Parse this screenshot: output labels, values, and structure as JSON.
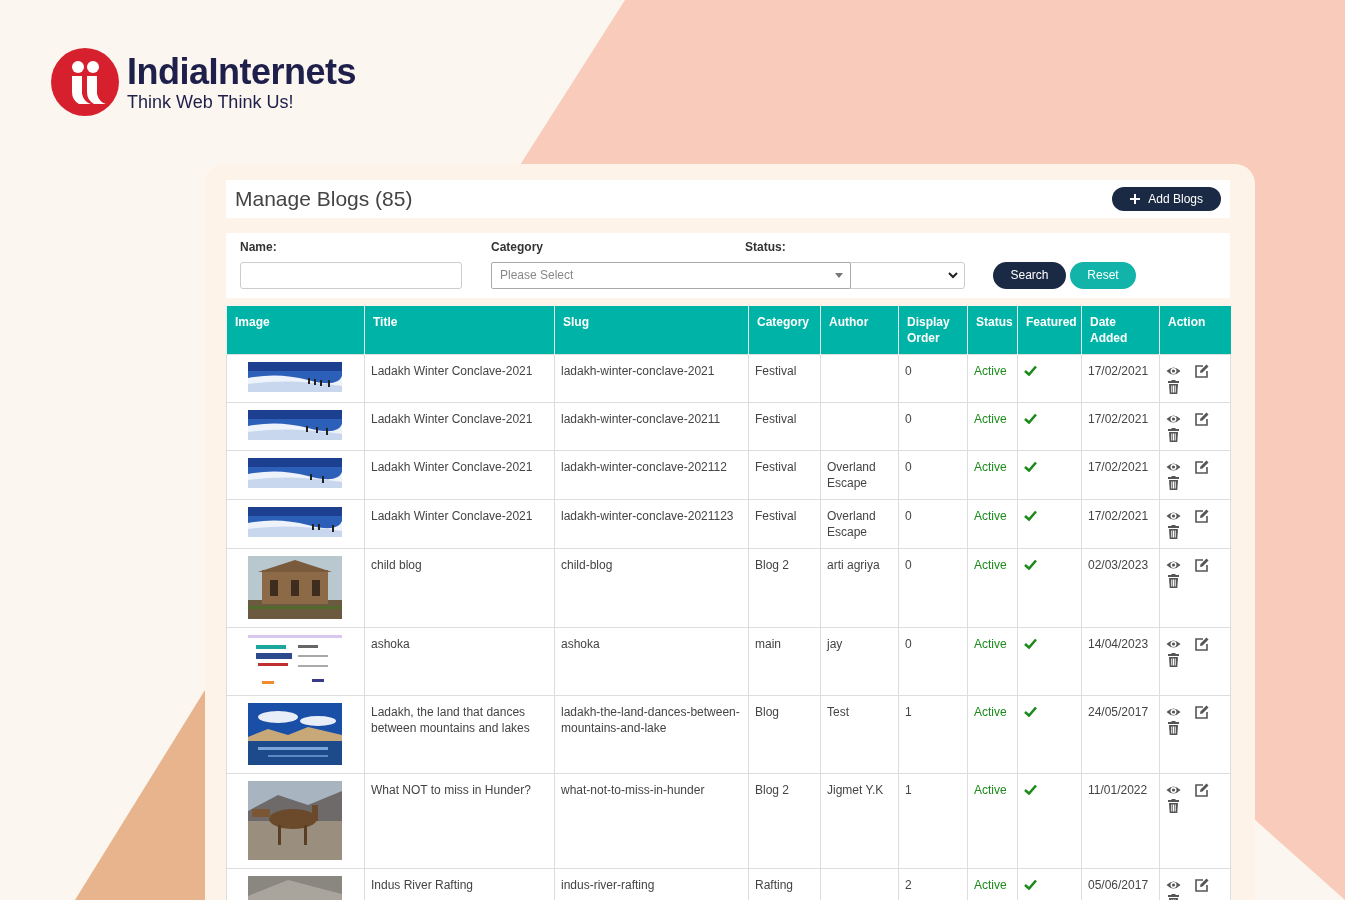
{
  "brand": {
    "name": "IndiaInternets",
    "tagline": "Think Web Think Us!"
  },
  "page": {
    "title": "Manage Blogs (85)",
    "add_button": "Add Blogs"
  },
  "filters": {
    "name_label": "Name:",
    "category_label": "Category",
    "category_placeholder": "Please Select",
    "status_label": "Status:",
    "search_button": "Search",
    "reset_button": "Reset"
  },
  "table": {
    "columns": [
      "Image",
      "Title",
      "Slug",
      "Category",
      "Author",
      "Display Order",
      "Status",
      "Featured",
      "Date Added",
      "Action"
    ],
    "rows": [
      {
        "title": "Ladakh Winter Conclave-2021",
        "slug": "ladakh-winter-conclave-2021",
        "category": "Festival",
        "display_order": "0",
        "status": "Active",
        "featured": true,
        "date_added": "17/02/2021"
      },
      {
        "title": "Ladakh Winter Conclave-2021",
        "slug": "ladakh-winter-conclave-20211",
        "category": "Festival",
        "display_order": "0",
        "status": "Active",
        "featured": true,
        "date_added": "17/02/2021"
      },
      {
        "title": "Ladakh Winter Conclave-2021",
        "slug": "ladakh-winter-conclave-202112",
        "category": "Festival",
        "author": "Overland Escape",
        "display_order": "0",
        "status": "Active",
        "featured": true,
        "date_added": "17/02/2021"
      },
      {
        "title": "Ladakh Winter Conclave-2021",
        "slug": "ladakh-winter-conclave-2021123",
        "category": "Festival",
        "author": "Overland Escape",
        "display_order": "0",
        "status": "Active",
        "featured": true,
        "date_added": "17/02/2021"
      },
      {
        "title": "child blog",
        "slug": "child-blog",
        "category": "Blog 2",
        "author": "arti agriya",
        "display_order": "0",
        "status": "Active",
        "featured": true,
        "date_added": "02/03/2023"
      },
      {
        "title": "ashoka",
        "slug": "ashoka",
        "category": "main",
        "author": "jay",
        "display_order": "0",
        "status": "Active",
        "featured": true,
        "date_added": "14/04/2023"
      },
      {
        "title": "Ladakh, the land that dances between mountains and lakes",
        "slug": "ladakh-the-land-dances-between-mountains-and-lake",
        "category": "Blog",
        "author": "Test",
        "display_order": "1",
        "status": "Active",
        "featured": true,
        "date_added": "24/05/2017"
      },
      {
        "title": "What NOT to miss in Hunder?",
        "slug": "what-not-to-miss-in-hunder",
        "category": "Blog 2",
        "author": "Jigmet Y.K",
        "display_order": "1",
        "status": "Active",
        "featured": true,
        "date_added": "11/01/2022"
      },
      {
        "title": "Indus River Rafting",
        "slug": "indus-river-rafting",
        "category": "Rafting",
        "display_order": "2",
        "status": "Active",
        "featured": true,
        "date_added": "05/06/2017"
      }
    ]
  }
}
